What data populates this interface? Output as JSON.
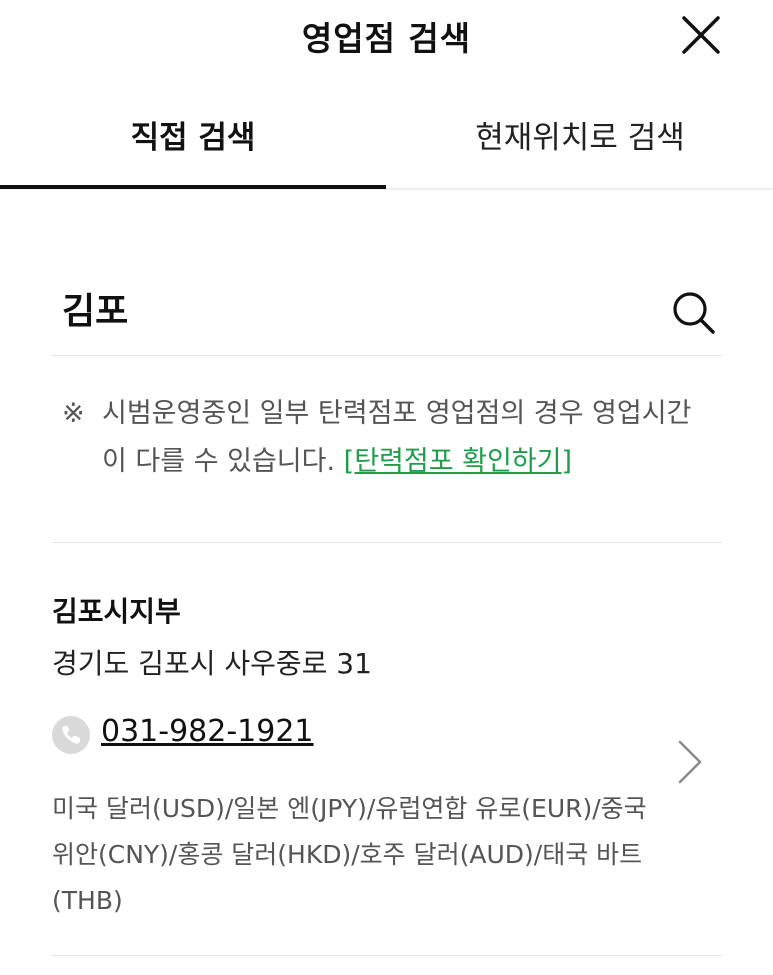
{
  "header": {
    "title": "영업점 검색",
    "close_icon": "close-icon"
  },
  "tabs": [
    {
      "label": "직접 검색",
      "active": true
    },
    {
      "label": "현재위치로 검색",
      "active": false
    }
  ],
  "search": {
    "value": "김포",
    "icon": "search-icon"
  },
  "notice": {
    "mark": "※",
    "text": "시범운영중인 일부 탄력점포 영업점의 경우 영업시간이 다를 수 있습니다.",
    "link": "[탄력점포 확인하기]",
    "link_color": "#1e9e4a"
  },
  "results": [
    {
      "name": "김포시지부",
      "address": "경기도 김포시 사우중로 31",
      "phone": "031-982-1921",
      "phone_icon": "phone-icon",
      "currencies": "미국 달러(USD)/일본 엔(JPY)/유럽연합 유로(EUR)/중국 위안(CNY)/홍콩 달러(HKD)/호주 달러(AUD)/태국 바트(THB)",
      "chevron_icon": "chevron-right-icon"
    }
  ]
}
